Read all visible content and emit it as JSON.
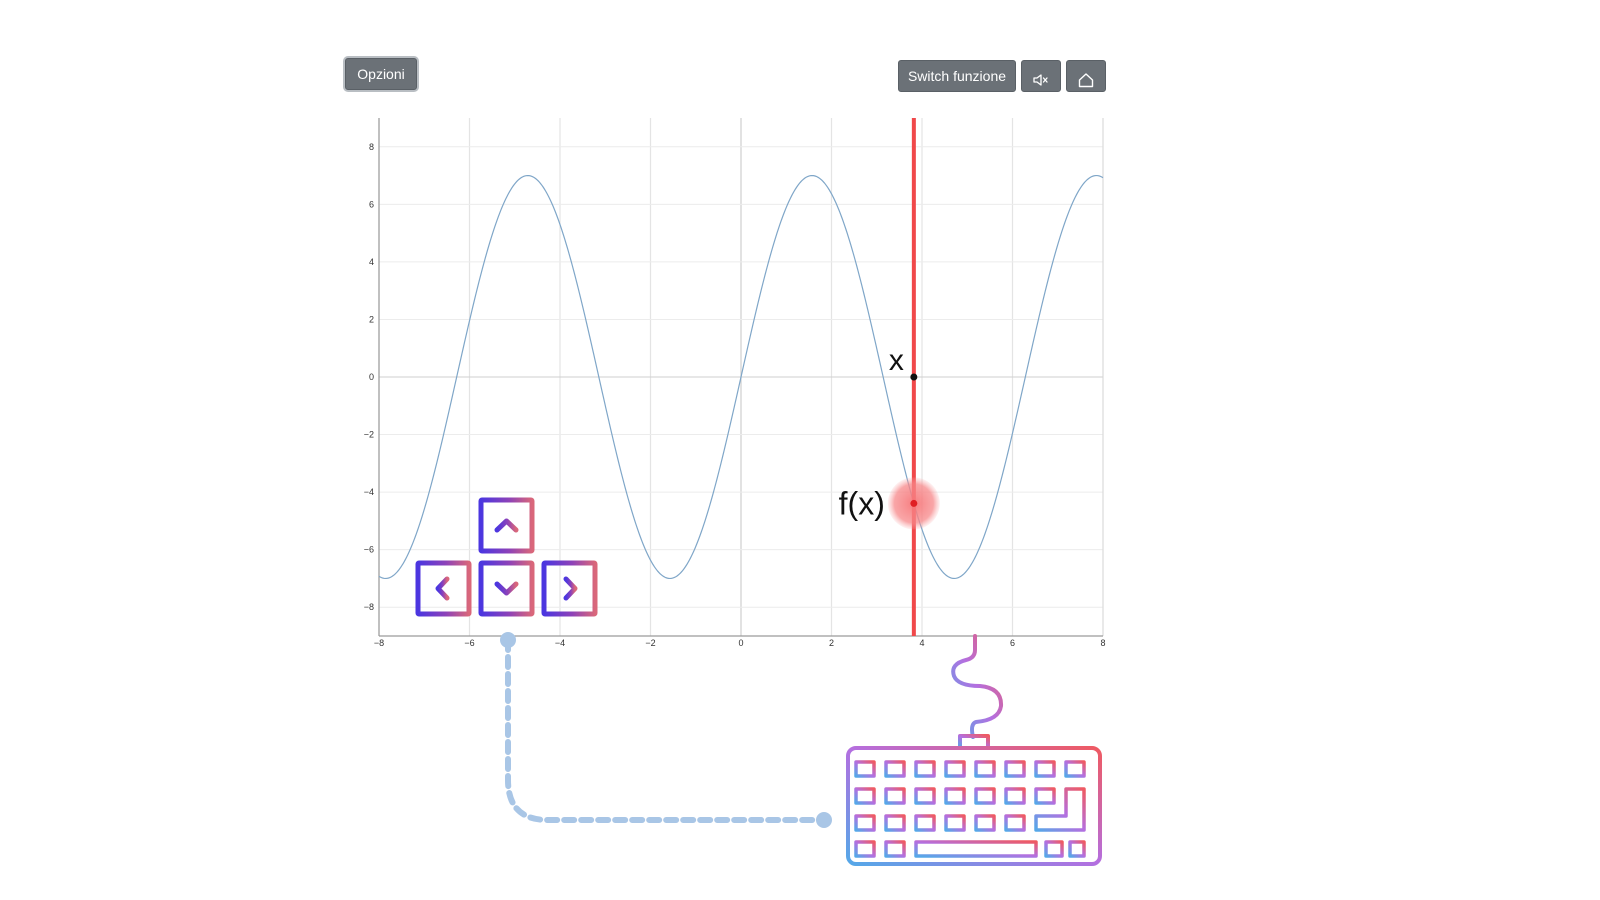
{
  "toolbar": {
    "options_label": "Opzioni",
    "switch_label": "Switch funzione",
    "mute_icon": "speaker-muted-icon",
    "home_icon": "home-icon"
  },
  "chart_data": {
    "type": "line",
    "function": "7*sin(x)",
    "x_range": [
      -8,
      8
    ],
    "ylim": [
      -9,
      9
    ],
    "x_ticks": [
      -8,
      -6,
      -4,
      -2,
      0,
      2,
      4,
      6,
      8
    ],
    "y_ticks": [
      -8,
      -6,
      -4,
      -2,
      0,
      2,
      4,
      6,
      8
    ],
    "grid": true,
    "line_color": "#7fa6c8",
    "cursor": {
      "x": 3.82,
      "color": "#f0484a"
    },
    "labels": {
      "x_marker": "x",
      "fx_marker": "f(x)"
    }
  },
  "controls": {
    "arrow_keys": [
      "up-arrow-key-icon",
      "left-arrow-key-icon",
      "down-arrow-key-icon",
      "right-arrow-key-icon"
    ],
    "keyboard_icon": "keyboard-icon",
    "connector_color": "#a9c6e6"
  }
}
